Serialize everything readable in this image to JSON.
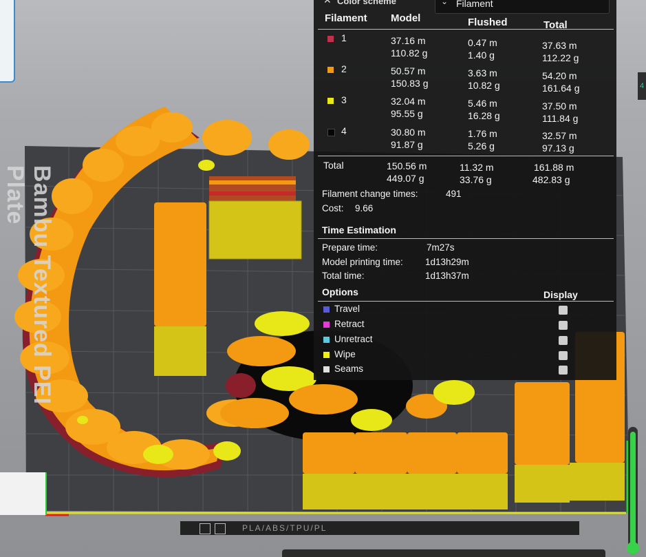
{
  "color_scheme": {
    "label": "Color scheme",
    "value": "Filament"
  },
  "table": {
    "headers": {
      "filament": "Filament",
      "model": "Model",
      "flushed": "Flushed",
      "total": "Total"
    },
    "rows": [
      {
        "id": "1",
        "color": "#c0314b",
        "model_len": "37.16 m",
        "model_wt": "110.82 g",
        "flushed_len": "0.47 m",
        "flushed_wt": "1.40 g",
        "total_len": "37.63 m",
        "total_wt": "112.22 g"
      },
      {
        "id": "2",
        "color": "#f39a12",
        "model_len": "50.57 m",
        "model_wt": "150.83 g",
        "flushed_len": "3.63 m",
        "flushed_wt": "10.82 g",
        "total_len": "54.20 m",
        "total_wt": "161.64 g"
      },
      {
        "id": "3",
        "color": "#e8e818",
        "model_len": "32.04 m",
        "model_wt": "95.55 g",
        "flushed_len": "5.46 m",
        "flushed_wt": "16.28 g",
        "total_len": "37.50 m",
        "total_wt": "111.84 g"
      },
      {
        "id": "4",
        "color": "#050505",
        "model_len": "30.80 m",
        "model_wt": "91.87 g",
        "flushed_len": "1.76 m",
        "flushed_wt": "5.26 g",
        "total_len": "32.57 m",
        "total_wt": "97.13 g"
      }
    ],
    "total": {
      "label": "Total",
      "model_len": "150.56 m",
      "model_wt": "449.07 g",
      "flushed_len": "11.32 m",
      "flushed_wt": "33.76 g",
      "total_len": "161.88 m",
      "total_wt": "482.83 g"
    }
  },
  "filament_change": {
    "label": "Filament change times:",
    "value": "491"
  },
  "cost": {
    "label": "Cost:",
    "value": "9.66"
  },
  "time_estimation": {
    "title": "Time Estimation",
    "prepare": {
      "label": "Prepare time:",
      "value": "7m27s"
    },
    "model_printing": {
      "label": "Model printing time:",
      "value": "1d13h29m"
    },
    "total": {
      "label": "Total time:",
      "value": "1d13h37m"
    }
  },
  "options": {
    "title": "Options",
    "display_label": "Display",
    "items": [
      {
        "label": "Travel",
        "color": "#5a5ad8"
      },
      {
        "label": "Retract",
        "color": "#e83ad8"
      },
      {
        "label": "Unretract",
        "color": "#5ac8e0"
      },
      {
        "label": "Wipe",
        "color": "#f0f018"
      },
      {
        "label": "Seams",
        "color": "#e0e0e0"
      }
    ]
  },
  "plate": {
    "side_label": "Bambu Textured PEI Plate",
    "filament_types": "PLA/ABS/TPU/PL"
  },
  "colors": {
    "orange": "#f39a12",
    "yellow": "#e8e818",
    "dark_red": "#8a1f2c",
    "black": "#050505",
    "plate": "#3c3d41",
    "accent_green": "#2bd13a"
  }
}
